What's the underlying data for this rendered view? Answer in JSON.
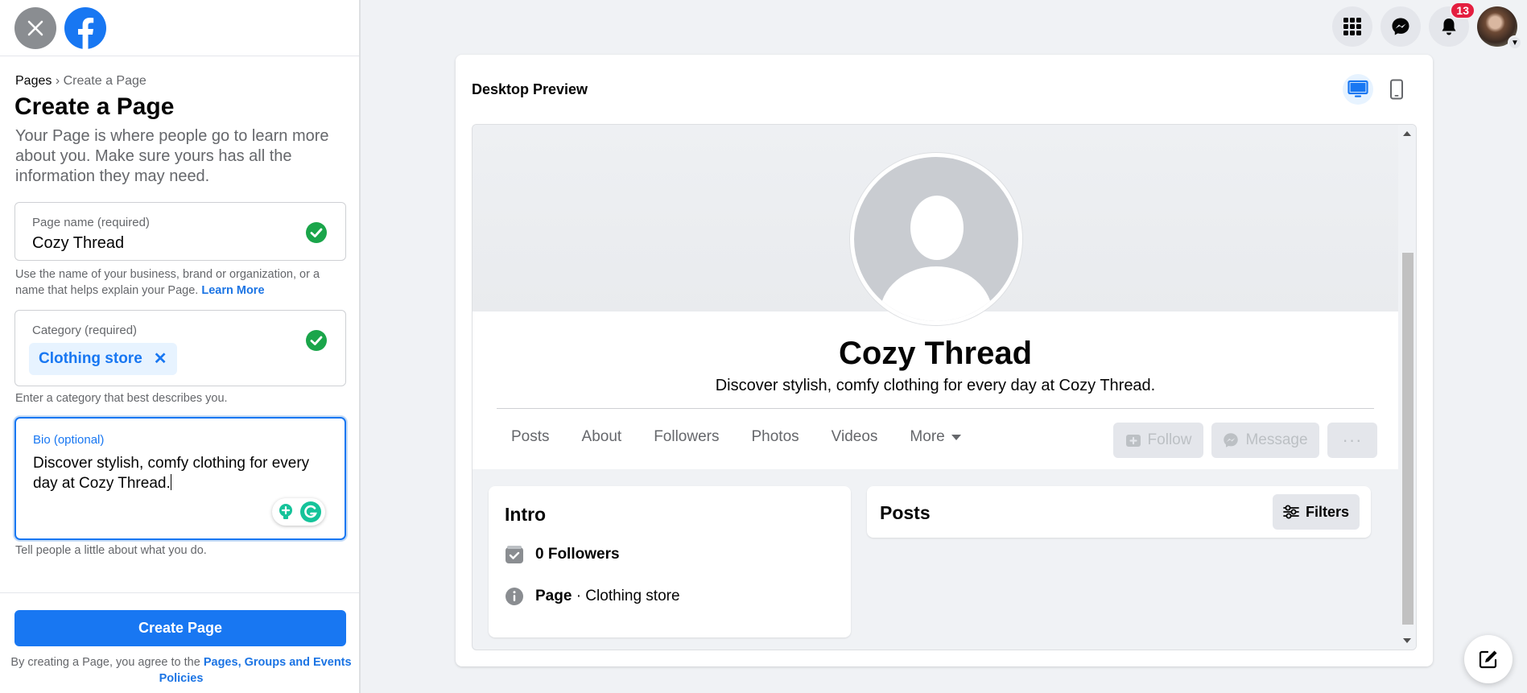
{
  "sidebar": {
    "breadcrumb": {
      "parent": "Pages",
      "separator": "›",
      "current": "Create a Page"
    },
    "title": "Create a Page",
    "description": "Your Page is where people go to learn more about you. Make sure yours has all the information they may need.",
    "page_name": {
      "label": "Page name (required)",
      "value": "Cozy Thread",
      "help": "Use the name of your business, brand or organization, or a name that helps explain your Page.",
      "learn_more": "Learn More"
    },
    "category": {
      "label": "Category (required)",
      "chip": "Clothing store",
      "chip_remove": "✕",
      "help": "Enter a category that best describes you."
    },
    "bio": {
      "label": "Bio (optional)",
      "value": "Discover stylish, comfy clothing for every day at Cozy Thread.",
      "help": "Tell people a little about what you do."
    },
    "create_button": "Create Page",
    "terms_prefix": "By creating a Page, you agree to the",
    "terms_link": "Pages, Groups and Events Policies"
  },
  "top_nav": {
    "notification_count": "13"
  },
  "preview": {
    "title": "Desktop Preview",
    "page_name": "Cozy Thread",
    "page_bio": "Discover stylish, comfy clothing for every day at Cozy Thread.",
    "tabs": [
      "Posts",
      "About",
      "Followers",
      "Photos",
      "Videos",
      "More"
    ],
    "actions": {
      "follow": "Follow",
      "message": "Message",
      "more": "···"
    },
    "intro": {
      "title": "Intro",
      "followers": "0 Followers",
      "page_label": "Page",
      "page_category": " · Clothing store"
    },
    "posts": {
      "title": "Posts",
      "filters": "Filters"
    }
  },
  "colors": {
    "brand": "#1877f2",
    "link": "#1b74e4",
    "badge": "#e41e3f",
    "check": "#1aa54a"
  }
}
